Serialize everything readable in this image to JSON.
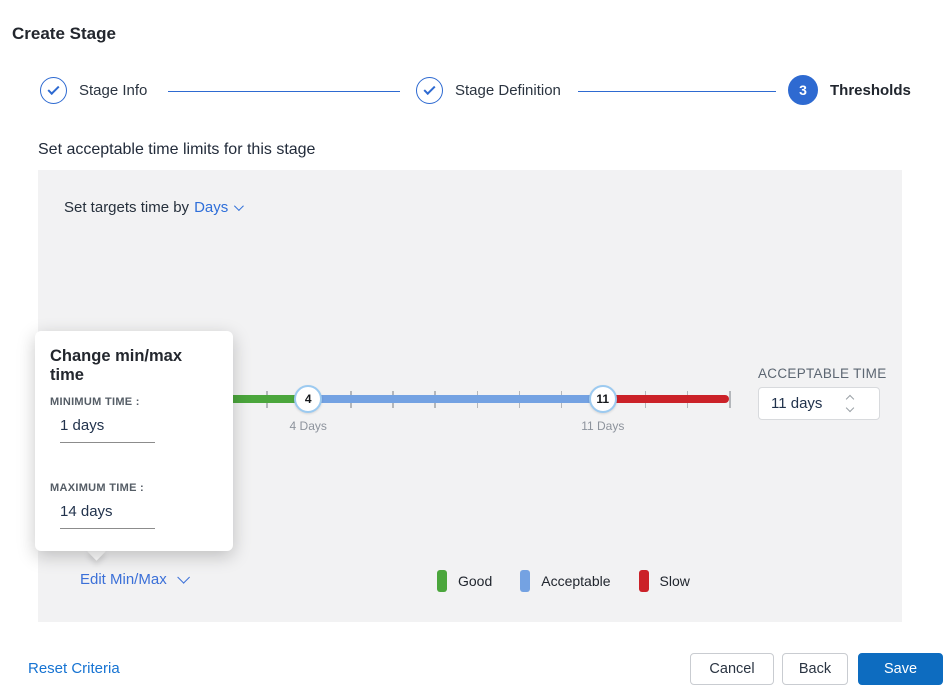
{
  "page": {
    "title": "Create Stage"
  },
  "stepper": {
    "steps": [
      {
        "label": "Stage Info",
        "state": "complete"
      },
      {
        "label": "Stage Definition",
        "state": "complete"
      },
      {
        "label": "Thresholds",
        "state": "current",
        "number": "3"
      }
    ]
  },
  "section": {
    "heading": "Set acceptable time limits for this stage"
  },
  "panel": {
    "targets_label": "Set targets time by",
    "targets_unit": "Days",
    "slider": {
      "min_day": 1,
      "max_day": 14,
      "good_end": 4,
      "acceptable_end": 11,
      "handle1_value": "4",
      "handle2_value": "11",
      "handle1_label": "4 Days",
      "handle2_label": "11 Days"
    },
    "acceptable_time": {
      "label": "ACCEPTABLE TIME",
      "value": "11 days"
    },
    "edit_minmax_label": "Edit Min/Max",
    "legend": [
      {
        "label": "Good",
        "color": "#4ba63c"
      },
      {
        "label": "Acceptable",
        "color": "#74a2e2"
      },
      {
        "label": "Slow",
        "color": "#cb2128"
      }
    ]
  },
  "popover": {
    "title": "Change min/max time",
    "min_label": "MINIMUM TIME :",
    "min_value": "1 days",
    "max_label": "MAXIMUM TIME :",
    "max_value": "14 days"
  },
  "footer": {
    "reset": "Reset Criteria",
    "cancel": "Cancel",
    "back": "Back",
    "save": "Save"
  },
  "colors": {
    "accent_blue": "#2e6ad1",
    "link_blue": "#2f6fd9",
    "save_blue": "#0d6cc0",
    "good_green": "#4ba63c",
    "acceptable_blue": "#74a2e2",
    "slow_red": "#cb2128",
    "panel_gray": "#f2f2f3"
  }
}
